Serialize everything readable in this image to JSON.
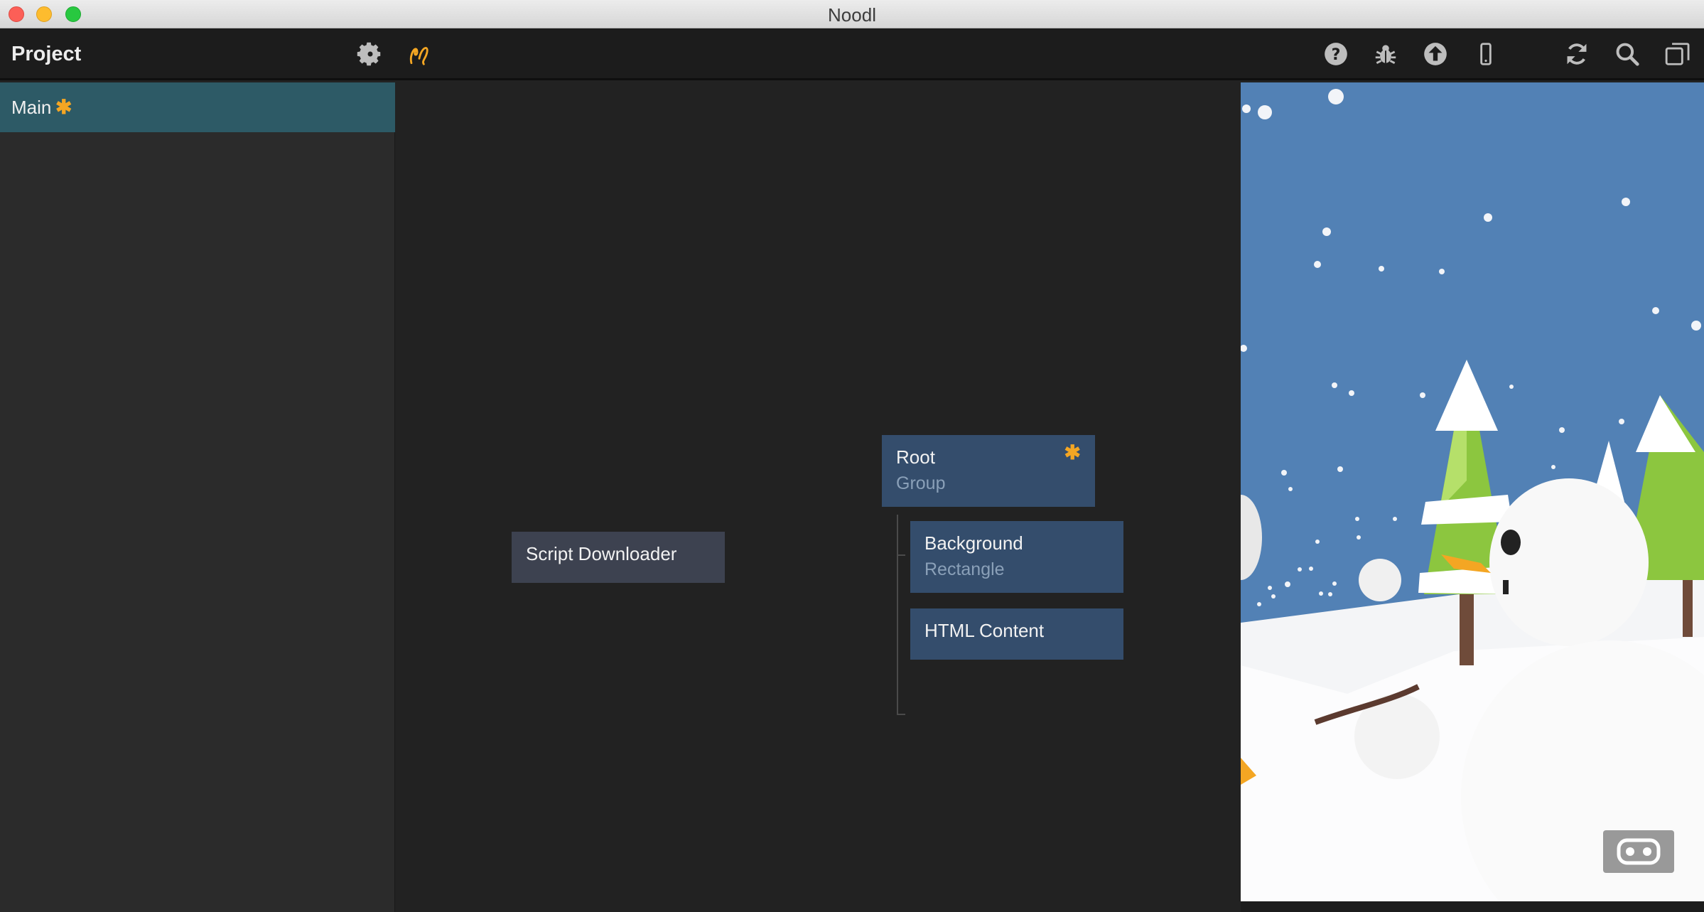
{
  "window": {
    "title": "Noodl"
  },
  "toolbar": {
    "project_label": "Project",
    "left_icons": [
      "gear-icon",
      "noodl-logo-icon"
    ],
    "right_icons": [
      "help-icon",
      "debug-bug-icon",
      "upload-icon",
      "mobile-device-icon",
      "refresh-icon",
      "search-icon",
      "windows-icon"
    ],
    "accent": "#f4a623"
  },
  "sidebar": {
    "items": [
      {
        "label": "Main",
        "modified_marker": "✱",
        "selected": true
      }
    ],
    "selected_color": "#2d5a66"
  },
  "canvas": {
    "nodes": [
      {
        "title": "Script Downloader",
        "subtitle": ""
      },
      {
        "title": "Root",
        "subtitle": "Group",
        "modified_marker": "✱"
      },
      {
        "title": "Background",
        "subtitle": "Rectangle"
      },
      {
        "title": "HTML Content",
        "subtitle": ""
      }
    ],
    "node_color": "#344d6c",
    "script_node_color": "#3d4250"
  },
  "preview": {
    "sky_color": "#5281b5",
    "vr_icon": "vr-goggles-icon"
  }
}
